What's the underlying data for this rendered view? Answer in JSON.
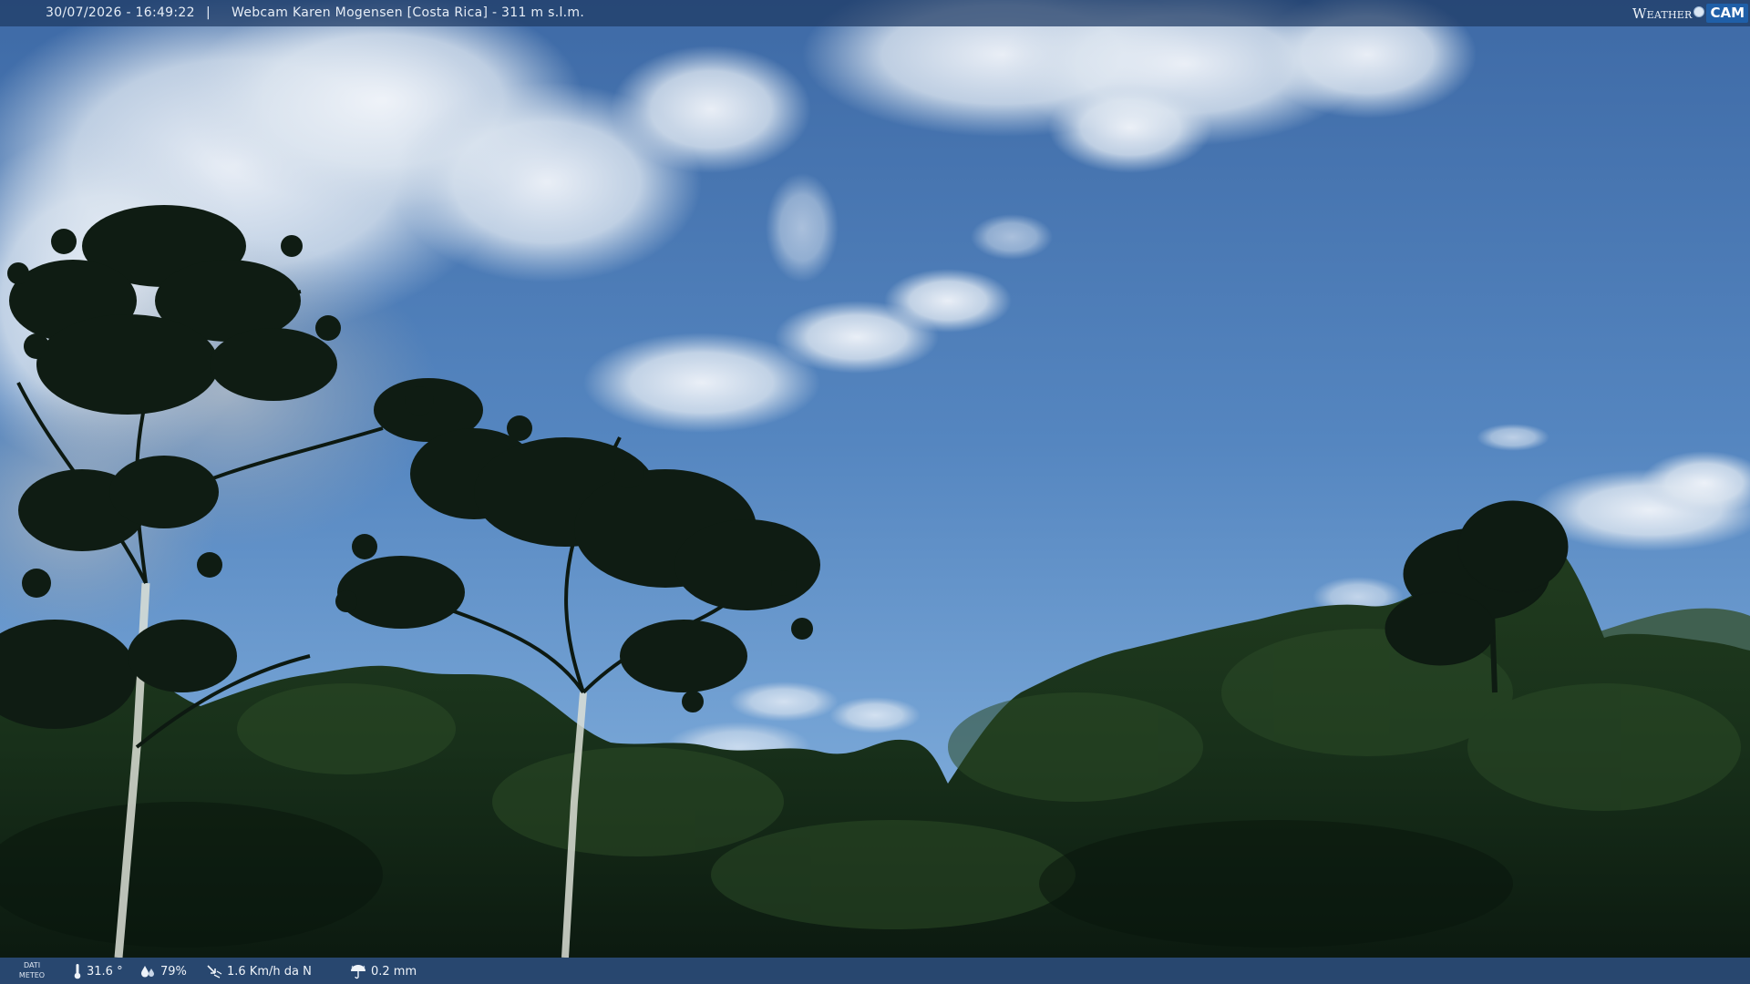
{
  "header": {
    "timestamp": "30/07/2026 - 16:49:22",
    "separator": "|",
    "camera_title": "Webcam Karen Mogensen [Costa Rica]  - 311 m s.l.m.",
    "logo": {
      "word": "Weather",
      "badge": "CAM"
    }
  },
  "footer": {
    "label_line1": "DATI",
    "label_line2": "METEO",
    "temperature": "31.6 °",
    "humidity": "79%",
    "wind": "1.6 Km/h da N",
    "rain": "0.2 mm"
  },
  "colors": {
    "sky_top": "#3f6fae",
    "sky_bottom": "#7aa7d8",
    "foliage_dark": "#0f1c13",
    "foliage_mid": "#1f3a1c",
    "bar_bg": "#1e3a64"
  },
  "icons": {
    "temperature": "thermometer-icon",
    "humidity": "droplets-icon",
    "wind": "wind-direction-icon",
    "rain": "umbrella-icon"
  }
}
